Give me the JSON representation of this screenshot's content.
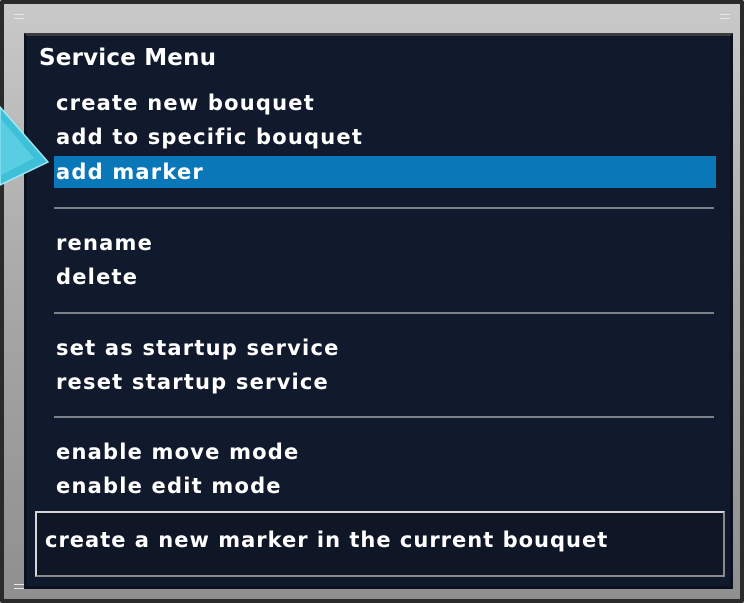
{
  "menu": {
    "title": "Service Menu",
    "group1": {
      "create_new_bouquet": "create new bouquet",
      "add_to_specific_bouquet": "add to specific bouquet",
      "add_marker": "add marker"
    },
    "group2": {
      "rename": "rename",
      "delete": "delete"
    },
    "group3": {
      "set_as_startup_service": "set as startup service",
      "reset_startup_service": "reset startup service"
    },
    "group4": {
      "enable_move_mode": "enable move mode",
      "enable_edit_mode": "enable edit mode"
    },
    "selected_item": "add marker"
  },
  "description": {
    "text": "create a new marker in the current bouquet"
  },
  "colors": {
    "panel_background": "#111a2d",
    "selection_highlight": "#0a77b8",
    "text": "#ffffff",
    "callout_arrow": "#3ec0d8"
  },
  "icons": {
    "callout": "callout-arrow-icon"
  }
}
